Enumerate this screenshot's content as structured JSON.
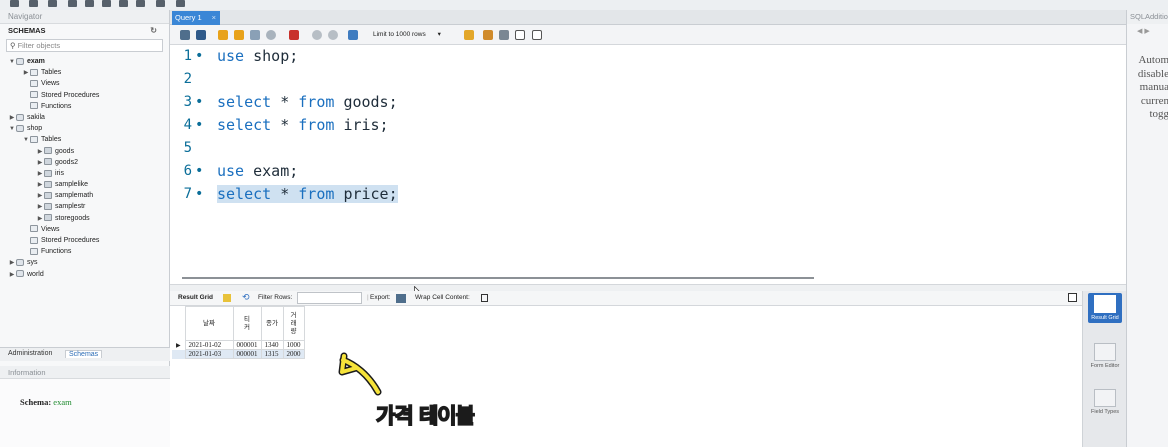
{
  "navigator": {
    "title": "Navigator",
    "schemas_label": "SCHEMAS",
    "filter_placeholder": "Filter objects",
    "tree": [
      {
        "label": "exam",
        "level": 0,
        "arrow": "▼",
        "kind": "db",
        "bold": true
      },
      {
        "label": "Tables",
        "level": 1,
        "arrow": "▶",
        "kind": "folder"
      },
      {
        "label": "Views",
        "level": 1,
        "arrow": "",
        "kind": "folder"
      },
      {
        "label": "Stored Procedures",
        "level": 1,
        "arrow": "",
        "kind": "folder"
      },
      {
        "label": "Functions",
        "level": 1,
        "arrow": "",
        "kind": "folder"
      },
      {
        "label": "sakila",
        "level": 0,
        "arrow": "▶",
        "kind": "db"
      },
      {
        "label": "shop",
        "level": 0,
        "arrow": "▼",
        "kind": "db"
      },
      {
        "label": "Tables",
        "level": 1,
        "arrow": "▼",
        "kind": "folder"
      },
      {
        "label": "goods",
        "level": 2,
        "arrow": "▶",
        "kind": "tbl"
      },
      {
        "label": "goods2",
        "level": 2,
        "arrow": "▶",
        "kind": "tbl"
      },
      {
        "label": "iris",
        "level": 2,
        "arrow": "▶",
        "kind": "tbl"
      },
      {
        "label": "samplelike",
        "level": 2,
        "arrow": "▶",
        "kind": "tbl"
      },
      {
        "label": "samplemath",
        "level": 2,
        "arrow": "▶",
        "kind": "tbl"
      },
      {
        "label": "samplestr",
        "level": 2,
        "arrow": "▶",
        "kind": "tbl"
      },
      {
        "label": "storegoods",
        "level": 2,
        "arrow": "▶",
        "kind": "tbl"
      },
      {
        "label": "Views",
        "level": 1,
        "arrow": "",
        "kind": "folder"
      },
      {
        "label": "Stored Procedures",
        "level": 1,
        "arrow": "",
        "kind": "folder"
      },
      {
        "label": "Functions",
        "level": 1,
        "arrow": "",
        "kind": "folder"
      },
      {
        "label": "sys",
        "level": 0,
        "arrow": "▶",
        "kind": "db"
      },
      {
        "label": "world",
        "level": 0,
        "arrow": "▶",
        "kind": "db"
      }
    ],
    "tabs": {
      "administration": "Administration",
      "schemas": "Schemas"
    },
    "information_title": "Information",
    "schema_label": "Schema:",
    "schema_value": "exam"
  },
  "query_tab": {
    "label": "Query 1",
    "close": "×"
  },
  "toolbar": {
    "limit_label": "Limit to 1000 rows"
  },
  "editor": {
    "lines": [
      {
        "num": "1",
        "dot": true,
        "text": "use shop;"
      },
      {
        "num": "2",
        "dot": false,
        "text": ""
      },
      {
        "num": "3",
        "dot": true,
        "text": "select * from goods;"
      },
      {
        "num": "4",
        "dot": true,
        "text": "select * from iris;"
      },
      {
        "num": "5",
        "dot": false,
        "text": ""
      },
      {
        "num": "6",
        "dot": true,
        "text": "use exam;"
      },
      {
        "num": "7",
        "dot": true,
        "text": "select * from price;",
        "highlighted": true
      }
    ]
  },
  "result": {
    "result_grid_label": "Result Grid",
    "filter_rows_label": "Filter Rows:",
    "export_label": "Export:",
    "wrap_label": "Wrap Cell Content:",
    "columns": [
      "날짜",
      "티커",
      "종가",
      "거래량"
    ],
    "rows": [
      [
        "2021-01-02",
        "000001",
        "1340",
        "1000"
      ],
      [
        "2021-01-03",
        "000001",
        "1315",
        "2000"
      ]
    ]
  },
  "result_sidebar": {
    "result_grid": "Result Grid",
    "form_editor": "Form Editor",
    "field_types": "Field Types"
  },
  "right_panel": {
    "title": "SQLAdditions",
    "nav": "◀ ▶",
    "text_lines": [
      "Autom",
      "disable",
      "manua",
      "curren",
      "togg"
    ]
  },
  "annotation": {
    "text": "가격 테이블",
    "color": "#f6e33a"
  }
}
